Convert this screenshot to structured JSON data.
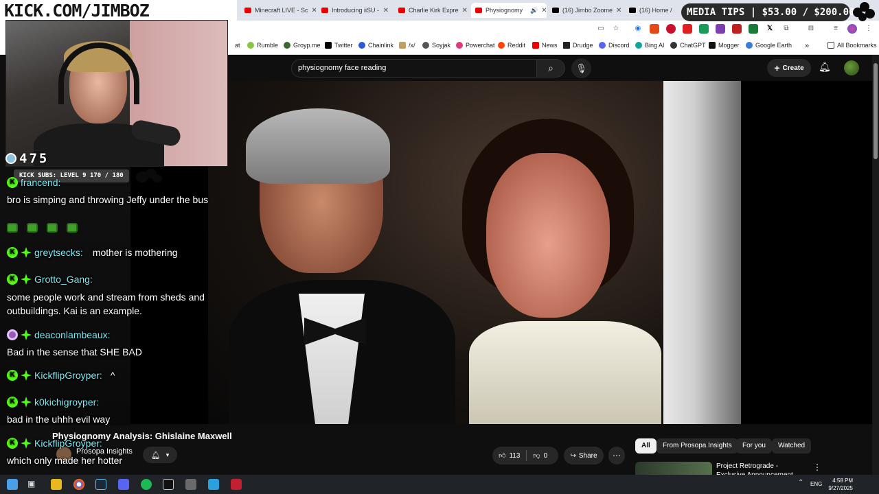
{
  "stream": {
    "banner": "KICK.COM/JIMBOZ",
    "viewers": "475",
    "kick_subs": "KICK SUBS: LEVEL 9 170 / 180",
    "media_tips": "MEDIA TIPS | $53.00 / $200.00"
  },
  "browser": {
    "tabs": [
      {
        "label": "Minecraft LIVE - Sc",
        "icon": "youtube-icon"
      },
      {
        "label": "Introducing iiSU -",
        "icon": "youtube-icon"
      },
      {
        "label": "Charlie Kirk Expre",
        "icon": "youtube-icon"
      },
      {
        "label": "Physiognomy",
        "icon": "youtube-icon"
      },
      {
        "label": "(16) Jimbo Zoome",
        "icon": "x-icon"
      },
      {
        "label": "(16) Home /",
        "icon": "x-icon"
      }
    ],
    "bookmarks": [
      {
        "label": "at",
        "icon": "globe-icon"
      },
      {
        "label": "Rumble",
        "icon": "rumble-icon"
      },
      {
        "label": "Groyp.me",
        "icon": "groyp-icon"
      },
      {
        "label": "Twitter",
        "icon": "x-icon"
      },
      {
        "label": "Chainlink",
        "icon": "chainlink-icon"
      },
      {
        "label": "/x/",
        "icon": "folder-icon"
      },
      {
        "label": "Soyjak",
        "icon": "soyjak-icon"
      },
      {
        "label": "Powerchat",
        "icon": "powerchat-icon"
      },
      {
        "label": "Reddit",
        "icon": "reddit-icon"
      },
      {
        "label": "News",
        "icon": "youtube-icon"
      },
      {
        "label": "Drudge",
        "icon": "drudge-icon"
      },
      {
        "label": "Discord",
        "icon": "discord-icon"
      },
      {
        "label": "Bing AI",
        "icon": "bing-icon"
      },
      {
        "label": "ChatGPT",
        "icon": "chatgpt-icon"
      },
      {
        "label": "Mogger",
        "icon": "mogger-icon"
      },
      {
        "label": "Google Earth",
        "icon": "google-earth-icon"
      }
    ],
    "all_bookmarks": "All Bookmarks"
  },
  "youtube": {
    "search_value": "physiognomy face reading",
    "create_label": "Create",
    "video_title": "Physiognomy Analysis: Ghislaine Maxwell",
    "channel_name": "Prosopa Insights",
    "likes": "113",
    "dislikes": "0",
    "share_label": "Share",
    "chips": [
      "All",
      "From Prosopa Insights",
      "For you",
      "Watched"
    ],
    "rec_title": "Project Retrograde - Exclusive Announcement Trailer"
  },
  "chat": [
    {
      "user": "francend:",
      "badges": [
        "kick"
      ]
    },
    {
      "text": "bro is simping and throwing Jeffy under the bus"
    },
    {
      "user": "greytsecks:",
      "inline": "mother is mothering",
      "badges": [
        "kick",
        "star"
      ]
    },
    {
      "user": "Grotto_Gang:",
      "badges": [
        "kick",
        "star"
      ]
    },
    {
      "text": "some people work and stream from sheds and outbuildings. Kai is an example."
    },
    {
      "user": "deaconlambeaux:",
      "badges": [
        "purple",
        "star"
      ]
    },
    {
      "text": "Bad in the sense that SHE BAD"
    },
    {
      "user": "KickflipGroyper:",
      "inline": "^",
      "badges": [
        "kick",
        "star"
      ]
    },
    {
      "user": "k0kichigroyper:",
      "badges": [
        "kick",
        "star"
      ]
    },
    {
      "text": "bad in the uhhh evil way"
    },
    {
      "user": "KickflipGroyper:",
      "badges": [
        "kick",
        "star"
      ]
    },
    {
      "text": "which only made her hotter"
    }
  ],
  "taskbar": {
    "lang": "ENG",
    "time": "4:58 PM",
    "date": "9/27/2025",
    "apps": [
      "explorer-icon",
      "chrome-icon",
      "steam-icon",
      "discord-icon",
      "spotify-icon",
      "terminal-icon",
      "sublime-icon",
      "telegram-icon",
      "obs-icon"
    ]
  },
  "colors": {
    "kick_green": "#53fc18",
    "chat_user": "#7ee7f0",
    "yt_bg": "#0f0f0f"
  }
}
